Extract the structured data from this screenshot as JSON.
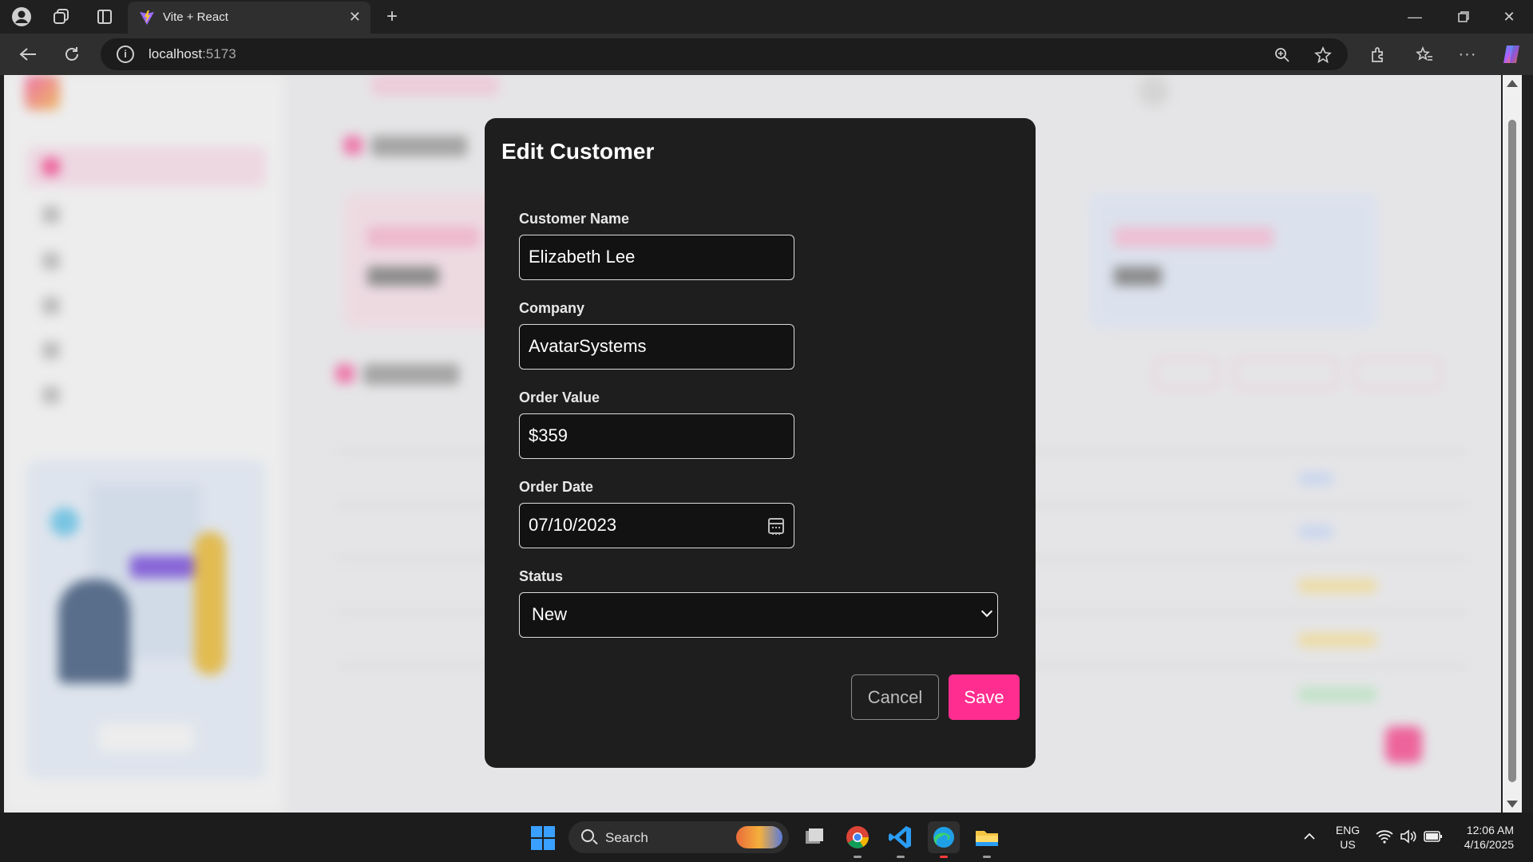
{
  "browser": {
    "tab_title": "Vite + React",
    "url_host": "localhost",
    "url_port": ":5173"
  },
  "modal": {
    "title": "Edit Customer",
    "fields": {
      "customer_name": {
        "label": "Customer Name",
        "value": "Elizabeth Lee"
      },
      "company": {
        "label": "Company",
        "value": "AvatarSystems"
      },
      "order_value": {
        "label": "Order Value",
        "value": "$359"
      },
      "order_date": {
        "label": "Order Date",
        "value": "07/10/2023"
      },
      "status": {
        "label": "Status",
        "value": "New"
      }
    },
    "cancel_label": "Cancel",
    "save_label": "Save"
  },
  "taskbar": {
    "search_label": "Search",
    "lang_top": "ENG",
    "lang_bottom": "US",
    "time": "12:06 AM",
    "date": "4/16/2025"
  },
  "colors": {
    "accent": "#ff2d8f",
    "modal_bg": "#1e1e1e",
    "input_bg": "#121212"
  }
}
